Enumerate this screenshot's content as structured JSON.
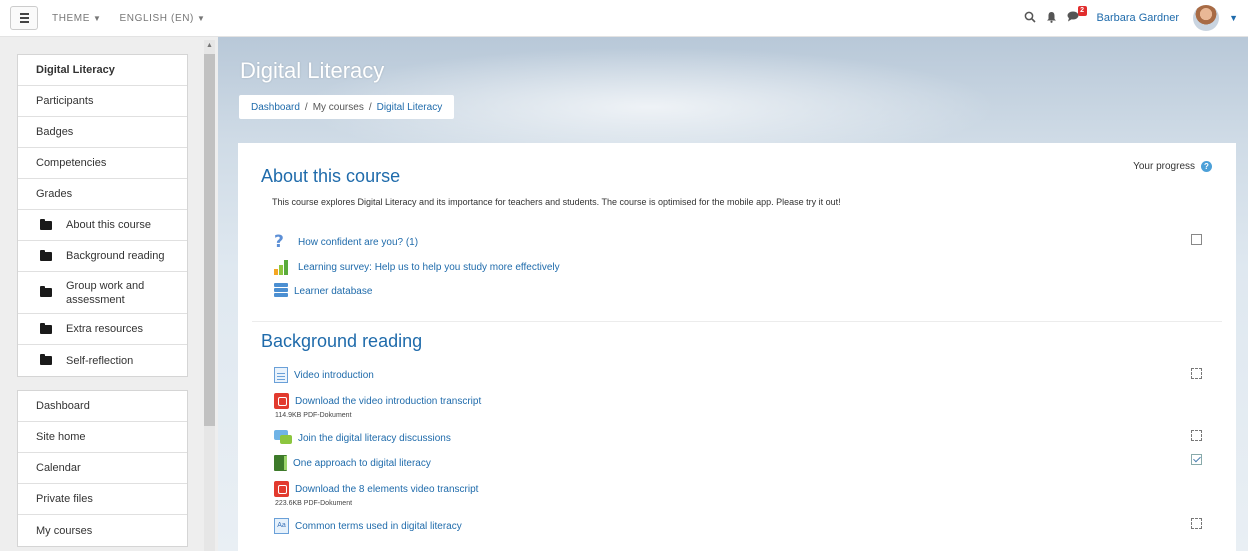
{
  "navbar": {
    "theme_label": "THEME",
    "language_label": "ENGLISH (EN)",
    "message_count": "2",
    "user_name": "Barbara Gardner"
  },
  "drawer": {
    "course_nav": [
      {
        "label": "Digital Literacy",
        "bold": true
      },
      {
        "label": "Participants"
      },
      {
        "label": "Badges"
      },
      {
        "label": "Competencies"
      },
      {
        "label": "Grades"
      },
      {
        "label": "About this course",
        "icon": "folder-icon"
      },
      {
        "label": "Background reading",
        "icon": "folder-icon"
      },
      {
        "label": "Group work and assessment",
        "icon": "folder-icon"
      },
      {
        "label": "Extra resources",
        "icon": "folder-icon"
      },
      {
        "label": "Self-reflection",
        "icon": "folder-icon"
      }
    ],
    "site_nav": [
      {
        "label": "Dashboard"
      },
      {
        "label": "Site home"
      },
      {
        "label": "Calendar"
      },
      {
        "label": "Private files"
      },
      {
        "label": "My courses"
      }
    ]
  },
  "header": {
    "title": "Digital Literacy",
    "breadcrumb": [
      "Dashboard",
      "My courses",
      "Digital Literacy"
    ]
  },
  "main": {
    "progress_label": "Your progress",
    "help_glyph": "?",
    "sections": [
      {
        "title": "About this course",
        "summary": "This course explores Digital Literacy and its importance for teachers and students. The course is optimised for the mobile app. Please try it out!",
        "activities": [
          {
            "label": "How confident are you? (1)",
            "icon": "quiz-icon",
            "completion": "manual-unchecked"
          },
          {
            "label": "Learning survey: Help us to help you study more effectively",
            "icon": "survey-icon",
            "completion": "none"
          },
          {
            "label": "Learner database",
            "icon": "database-icon",
            "completion": "none"
          }
        ]
      },
      {
        "title": "Background reading",
        "activities": [
          {
            "label": "Video introduction",
            "icon": "page-icon",
            "completion": "auto-unchecked"
          },
          {
            "label": "Download the video introduction transcript",
            "icon": "pdf-icon",
            "meta": "114.9KB PDF-Dokument",
            "completion": "none"
          },
          {
            "label": "Join the digital literacy discussions",
            "icon": "forum-icon",
            "completion": "auto-unchecked"
          },
          {
            "label": "One approach to digital literacy",
            "icon": "book-icon",
            "completion": "auto-checked"
          },
          {
            "label": "Download the 8 elements video transcript",
            "icon": "pdf-icon",
            "meta": "223.6KB PDF-Dokument",
            "completion": "none"
          },
          {
            "label": "Common terms used in digital literacy",
            "icon": "glossary-icon",
            "glyph": "Aa",
            "completion": "auto-unchecked"
          }
        ]
      }
    ]
  },
  "colors": {
    "link": "#1f6bab",
    "badge": "#e12d2d"
  }
}
